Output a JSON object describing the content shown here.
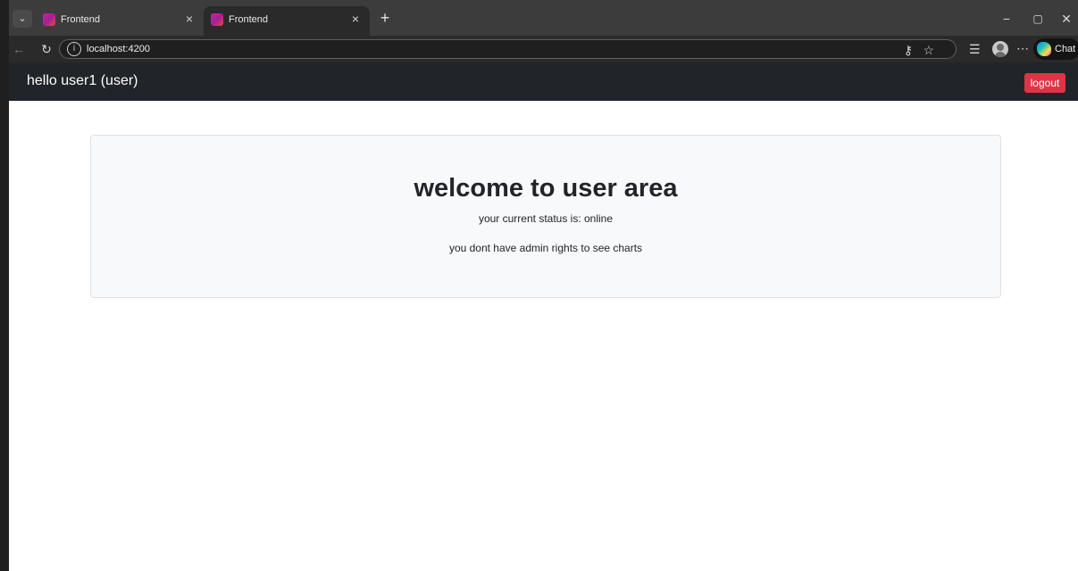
{
  "browser": {
    "tabs": [
      {
        "title": "Frontend",
        "active": false
      },
      {
        "title": "Frontend",
        "active": true
      }
    ],
    "url": "localhost:4200",
    "copilot_label": "Chat",
    "icons": {
      "tab_menu": "chevron-down-icon",
      "tab_close": "close-icon",
      "new_tab": "plus-icon",
      "back": "back-arrow-icon",
      "reload": "reload-icon",
      "site_info": "info-icon",
      "password": "key-icon",
      "favorite": "star-icon",
      "favorites": "favorites-icon",
      "profile": "profile-icon",
      "more": "more-icon",
      "minimize": "minimize-icon",
      "maximize": "maximize-icon",
      "close": "close-icon"
    }
  },
  "navbar": {
    "greeting": "hello user1 (user)",
    "logout_label": "logout"
  },
  "main": {
    "title": "welcome to user area",
    "status_text": "your current status is: online",
    "rights_text": "you dont have admin rights to see charts"
  },
  "colors": {
    "navbar_bg": "#212529",
    "logout_bg": "#dc3545",
    "card_bg": "#f8f9fa",
    "card_border": "#dee2e6",
    "text": "#212529"
  }
}
